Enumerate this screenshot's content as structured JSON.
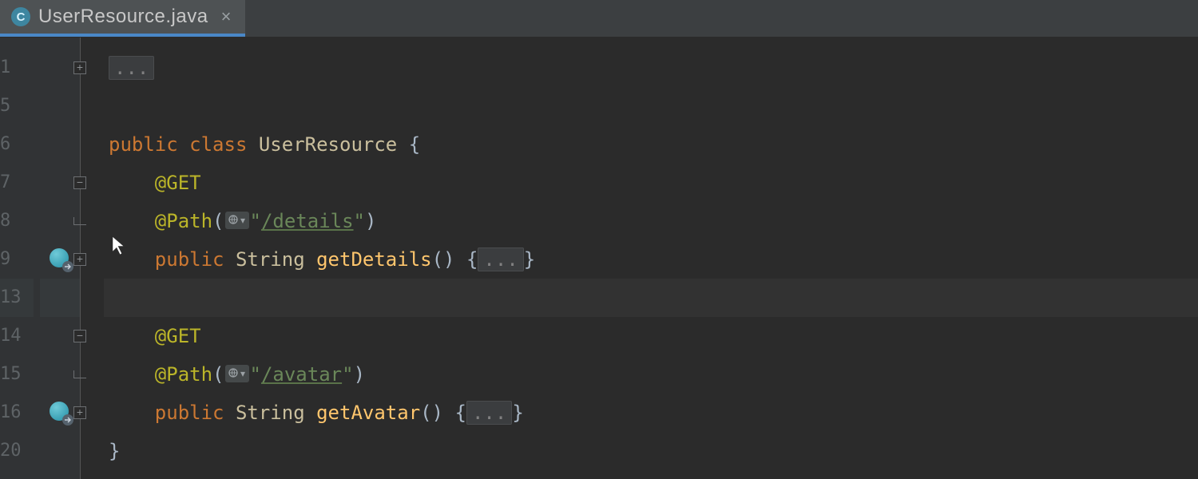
{
  "tab": {
    "icon_letter": "C",
    "title": "UserResource.java",
    "close": "×"
  },
  "gutter": {
    "numbers": [
      "1",
      "5",
      "6",
      "7",
      "8",
      "9",
      "13",
      "14",
      "15",
      "16",
      "20"
    ],
    "folds": [
      "plus",
      "",
      "",
      "minus",
      "end",
      "plus",
      "",
      "minus",
      "end",
      "plus",
      ""
    ],
    "icons": [
      "",
      "",
      "",
      "",
      "",
      "endpoint",
      "",
      "",
      "",
      "endpoint",
      ""
    ]
  },
  "code": {
    "l0_fold": "...",
    "l2": {
      "kw1": "public",
      "kw2": "class",
      "name": "UserResource",
      "brace": "{"
    },
    "l3_ann": "@GET",
    "l4": {
      "ann": "@Path",
      "open": "(",
      "str": "\"",
      "path": "/details",
      "strEnd": "\"",
      "close": ")"
    },
    "l5": {
      "kw": "public",
      "type": "String",
      "fn": "getDetails",
      "parens": "()",
      "brace": "{",
      "fold": "...",
      "brace2": "}"
    },
    "l7_ann": "@GET",
    "l8": {
      "ann": "@Path",
      "open": "(",
      "str": "\"",
      "path": "/avatar",
      "strEnd": "\"",
      "close": ")"
    },
    "l9": {
      "kw": "public",
      "type": "String",
      "fn": "getAvatar",
      "parens": "()",
      "brace": "{",
      "fold": "...",
      "brace2": "}"
    },
    "l10_brace": "}"
  }
}
